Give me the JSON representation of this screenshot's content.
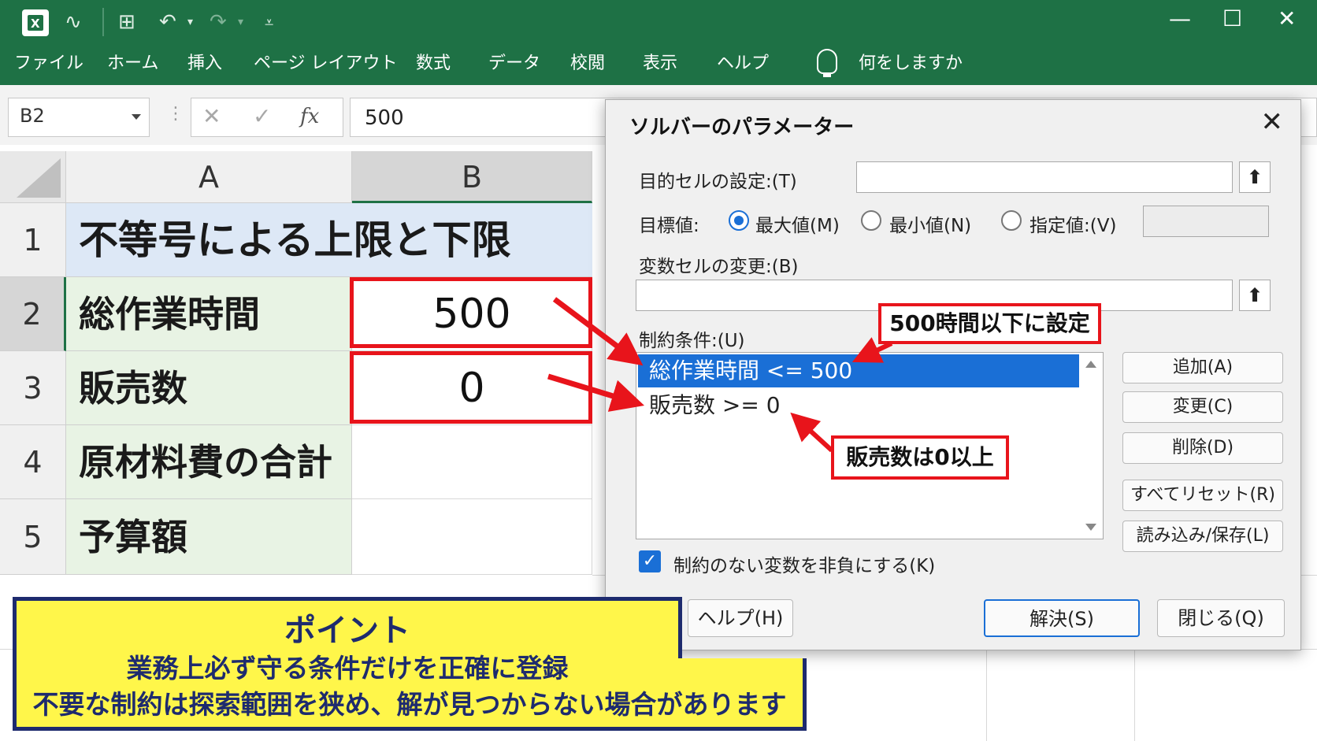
{
  "window": {
    "minimize": "—",
    "maximize": "☐",
    "close": "✕"
  },
  "quick_access": {
    "autosave": "∿",
    "grid": "⊞",
    "undo": "↶",
    "undo_caret": "▾",
    "redo": "↷",
    "redo_caret": "▾",
    "customize": "⩡"
  },
  "ribbon": {
    "tabs": [
      "ファイル",
      "ホーム",
      "挿入",
      "ページ レイアウト",
      "数式",
      "データ",
      "校閲",
      "表示",
      "ヘルプ"
    ],
    "tell_me": "何をしますか"
  },
  "formula_bar": {
    "name_box": "B2",
    "colon": "⋮",
    "cancel": "✕",
    "enter": "✓",
    "fx": "fx",
    "value": "500"
  },
  "sheet": {
    "columns": [
      "A",
      "B"
    ],
    "rows": [
      "1",
      "2",
      "3",
      "4",
      "5"
    ],
    "title": "不等号による上限と下限",
    "labels": [
      "総作業時間",
      "販売数",
      "原材料費の合計",
      "予算額"
    ],
    "values": [
      "500",
      "0",
      "",
      ""
    ],
    "selected_cell": "B2"
  },
  "dialog": {
    "title": "ソルバーのパラメーター",
    "close": "✕",
    "objective_label": "目的セルの設定:(T)",
    "objective_value": "",
    "goal_label": "目標値:",
    "goal_options": [
      "最大値(M)",
      "最小値(N)",
      "指定値:(V)"
    ],
    "goal_selected": "最大値(M)",
    "specified_value": "",
    "variable_label": "変数セルの変更:(B)",
    "variable_value": "",
    "upload_icon": "⬆",
    "constraints_label": "制約条件:(U)",
    "constraints": [
      "総作業時間 <= 500",
      "販売数 >= 0"
    ],
    "buttons_side": [
      "追加(A)",
      "変更(C)",
      "削除(D)",
      "すべてリセット(R)",
      "読み込み/保存(L)"
    ],
    "nonneg_checked": true,
    "nonneg_checkmark": "✓",
    "nonneg_label": "制約のない変数を非負にする(K)",
    "help": "ヘルプ(H)",
    "solve": "解決(S)",
    "close_button": "閉じる(Q)"
  },
  "annotations": {
    "callout_upper": "500時間以下に設定",
    "callout_lower": "販売数は0以上",
    "point_title": "ポイント",
    "point_line1": "業務上必ず守る条件だけを正確に登録",
    "point_line2": "不要な制約は探索範囲を狭め、解が見つからない場合があります"
  },
  "colors": {
    "excel_green": "#1e7145",
    "highlight_red": "#e8141b",
    "selection_blue": "#1a6fd6",
    "point_yellow": "#fff64a",
    "point_navy": "#1e2b6e"
  }
}
